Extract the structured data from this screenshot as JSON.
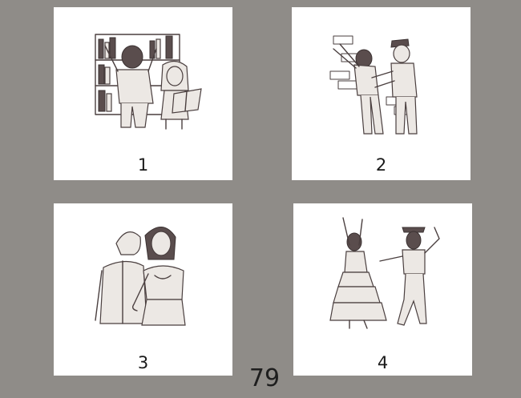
{
  "cards": [
    {
      "number": "1",
      "illustration": "children-at-bookshelf-icon"
    },
    {
      "number": "2",
      "illustration": "police-frisk-at-wall-icon"
    },
    {
      "number": "3",
      "illustration": "couple-arm-in-arm-icon"
    },
    {
      "number": "4",
      "illustration": "couple-dancing-icon"
    }
  ],
  "page_number": "79",
  "colors": {
    "background": "#8f8c88",
    "card": "#ffffff",
    "ink": "#4a3f3f"
  }
}
